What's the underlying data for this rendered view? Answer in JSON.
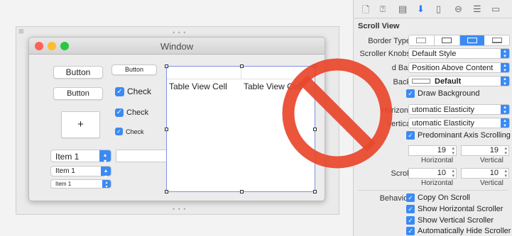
{
  "canvas": {
    "window_title": "Window",
    "frame_dots": "• • •",
    "buttons": [
      "Button",
      "Button",
      "Button"
    ],
    "add_glyph": "+",
    "checks": [
      "Check",
      "Check",
      "Check"
    ],
    "popups": [
      "Item 1",
      "Item 1",
      "Item 1"
    ],
    "table_cells": [
      "Table View Cell",
      "Table View Cell"
    ],
    "traffic_colors": [
      "#ff5f57",
      "#febc2e",
      "#28c840"
    ]
  },
  "inspector": {
    "tab_icons": [
      "file-icon",
      "help-icon",
      "identity-icon",
      "attributes-icon",
      "size-icon",
      "connections-icon",
      "bindings-icon",
      "effects-icon"
    ],
    "section": "Scroll View",
    "border_type_label": "Border Type",
    "scroller_knobs_label": "Scroller Knobs",
    "scroller_knobs_value": "Default Style",
    "find_bar_label": "d Bar",
    "find_bar_value": "Position Above Content",
    "background_label": "Back",
    "background_value": "Default",
    "draw_background": "Draw Background",
    "horizontal_label": "Horizont",
    "horizontal_value": "utomatic Elasticity",
    "vertical_label": "Vertica",
    "vertical_value": "utomatic Elasticity",
    "predominant": "Predominant Axis Scrolling",
    "line_h": "19",
    "line_v": "19",
    "sub_horizontal": "Horizontal",
    "sub_vertical": "Vertical",
    "scroll_label": "Scroll",
    "page_h": "10",
    "page_v": "10",
    "behavior_label": "Behavior",
    "copy_on_scroll": "Copy On Scroll",
    "show_h_scroller": "Show Horizontal Scroller",
    "show_v_scroller": "Show Vertical Scroller",
    "auto_hide": "Automatically Hide Scroller",
    "accent_color": "#3b8af3"
  },
  "overlay": {
    "icon": "no-entry-icon",
    "color": "#e8472b"
  }
}
